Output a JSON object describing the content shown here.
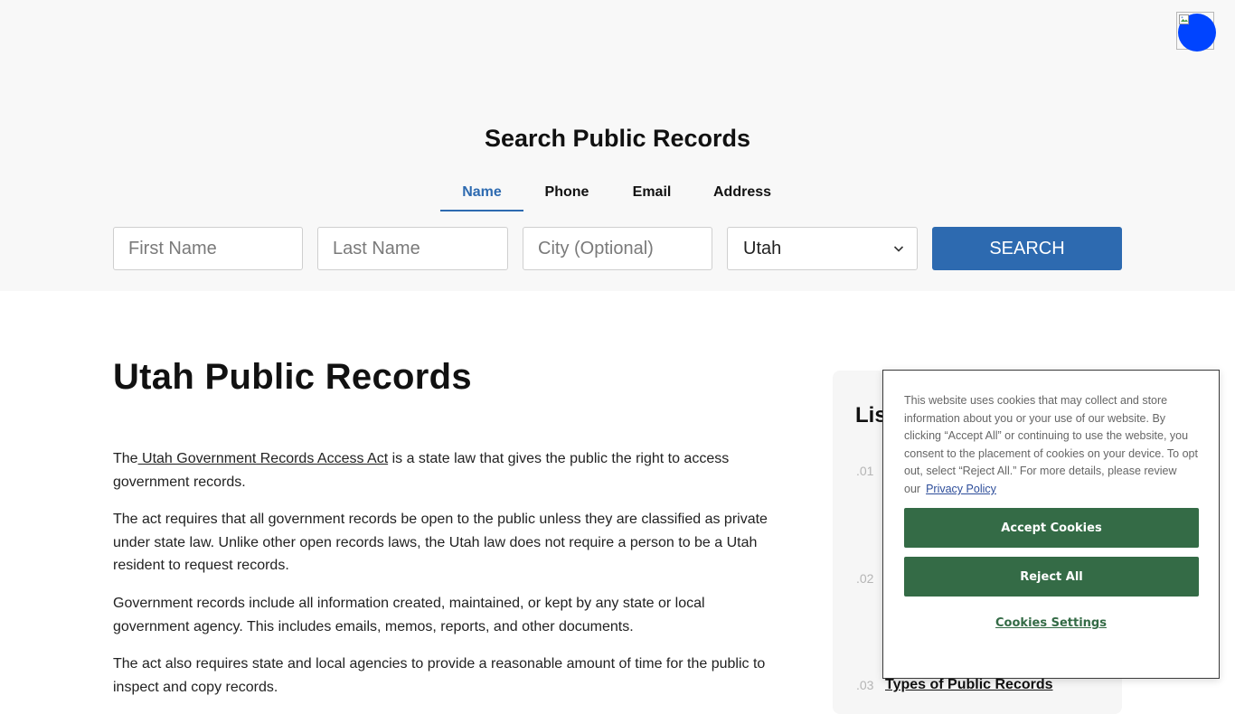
{
  "header": {
    "search_title": "Search Public Records",
    "tabs": [
      {
        "label": "Name",
        "active": true
      },
      {
        "label": "Phone",
        "active": false
      },
      {
        "label": "Email",
        "active": false
      },
      {
        "label": "Address",
        "active": false
      }
    ],
    "form": {
      "first_name_placeholder": "First Name",
      "last_name_placeholder": "Last Name",
      "city_placeholder": "City (Optional)",
      "state_selected": "Utah",
      "search_label": "SEARCH"
    }
  },
  "main": {
    "title": "Utah Public Records",
    "paragraphs": {
      "p1_before": "The",
      "p1_link": " Utah Government Records Access Act",
      "p1_after": " is a state law that gives the public the right to access government records.",
      "p2": "The act requires that all government records be open to the public unless they are classified as private under state law. Unlike other open records laws, the Utah law does not require a person to be a Utah resident to request records.",
      "p3": "Government records include all information created, maintained, or kept by any state or local government agency. This includes emails, memos, reports, and other documents.",
      "p4": "The act also requires state and local agencies to provide a reasonable amount of time for the public to inspect and copy records."
    }
  },
  "sidebar": {
    "title": "Lis",
    "numbers": [
      ".01",
      ".02",
      ".03"
    ],
    "item3_label": "Types of Public Records"
  },
  "cookie_banner": {
    "text": "This website uses cookies that may collect and store information about you or your use of our website. By clicking “Accept All” or continuing to use the website, you consent to the placement of cookies on your device. To opt out, select “Reject All.” For more details, please review our",
    "privacy_link": "Privacy Policy",
    "accept_label": "Accept Cookies",
    "reject_label": "Reject All",
    "settings_label": "Cookies Settings"
  },
  "colors": {
    "brand_blue": "#2d6ab0",
    "cookie_green": "#346b46",
    "avatar_blue": "#0044ff"
  },
  "icons": {
    "avatar": "broken-image-icon",
    "select": "chevron-down-icon"
  }
}
